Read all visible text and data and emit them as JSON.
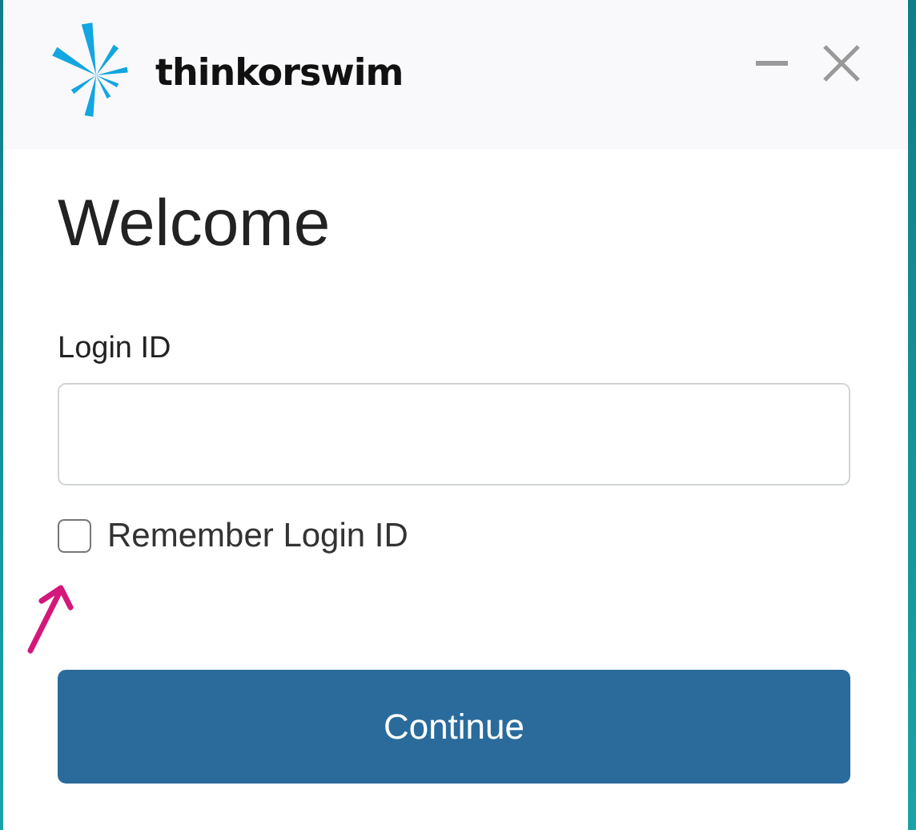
{
  "header": {
    "logo_text": "thinkorswim"
  },
  "title": "Welcome",
  "login_field": {
    "label": "Login ID"
  },
  "remember": {
    "label": "Remember Login ID",
    "checked": false
  },
  "button": {
    "label": "Continue"
  }
}
